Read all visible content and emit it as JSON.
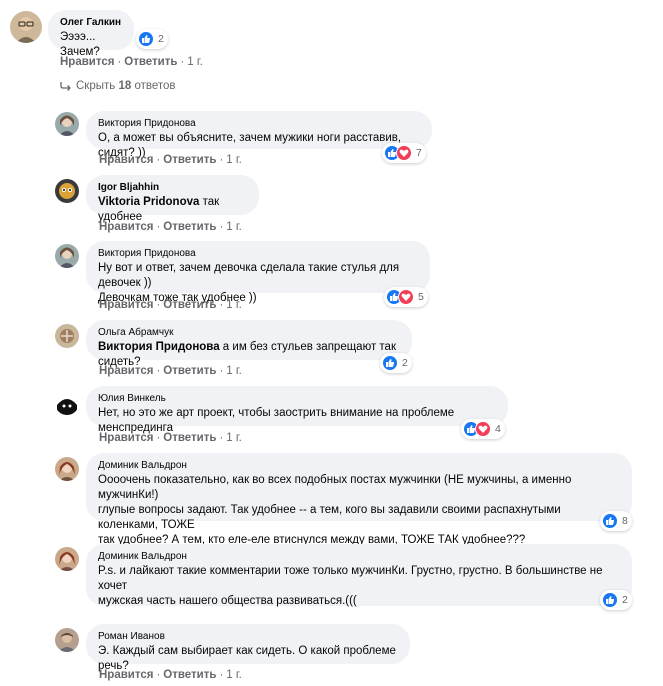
{
  "top": {
    "author": "Олег Галкин",
    "text": "Ээээ... Зачем?",
    "count": "2",
    "like": "Нравится",
    "reply": "Ответить",
    "time": "1 г."
  },
  "replies_toggle": {
    "prefix": "Скрыть",
    "count": "18",
    "suffix": "ответов"
  },
  "replies": [
    {
      "author": "Виктория Придонова",
      "lines": [
        "О, а может вы объясните, зачем мужики ноги расставив, сидят? ))"
      ],
      "count": "7",
      "like": "Нравится",
      "reply": "Ответить",
      "time": "1 г."
    },
    {
      "author": "Igor Bljahhin",
      "mention": "Viktoria Pridonova",
      "text": " так удобнее",
      "like": "Нравится",
      "reply": "Ответить",
      "time": "1 г."
    },
    {
      "author": "Виктория Придонова",
      "lines": [
        "Ну вот и ответ, зачем девочка сделала такие стулья для девочек ))",
        "Девочкам тоже так удобнее ))"
      ],
      "count": "5",
      "like": "Нравится",
      "reply": "Ответить",
      "time": "1 г."
    },
    {
      "author": "Ольга Абрамчук",
      "mention": "Виктория Придонова",
      "text": " а им без стульев запрещают так сидеть?",
      "count": "2",
      "like": "Нравится",
      "reply": "Ответить",
      "time": "1 г."
    },
    {
      "author": "Юлия Винкель",
      "lines": [
        "Нет, но это же арт проект, чтобы заострить внимание на проблеме менспрединга"
      ],
      "count": "4",
      "like": "Нравится",
      "reply": "Ответить",
      "time": "1 г."
    },
    {
      "author": "Доминик Вальдрон",
      "lines": [
        "Оооочень показательно, как во всех подобных постах мужчинки (НЕ мужчины, а именно мужчинКи!)",
        "глупые вопросы задают. Так удобнее -- а тем, кого вы задавили своими распахнутыми коленками, ТОЖЕ",
        "так удобнее? А тем, кто еле-еле втиснулся между вами, ТОЖЕ ТАК удобнее???"
      ],
      "count": "8"
    },
    {
      "author": "Доминик Вальдрон",
      "lines": [
        "P.s. и лайкают такие комментарии тоже только мужчинКи. Грустно, грустно. В большинстве не хочет",
        "мужская часть нашего общества развиваться.((("
      ],
      "count": "2"
    },
    {
      "author": "Роман Иванов",
      "lines": [
        "Э. Каждый сам выбирает как сидеть. О какой проблеме речь?"
      ],
      "like": "Нравится",
      "reply": "Ответить",
      "time": "1 г."
    }
  ],
  "colors": {
    "like_blue": "#1877f2",
    "love_red": "#f33e58",
    "bubble_bg": "#f0f2f5",
    "meta_gray": "#65676b"
  }
}
